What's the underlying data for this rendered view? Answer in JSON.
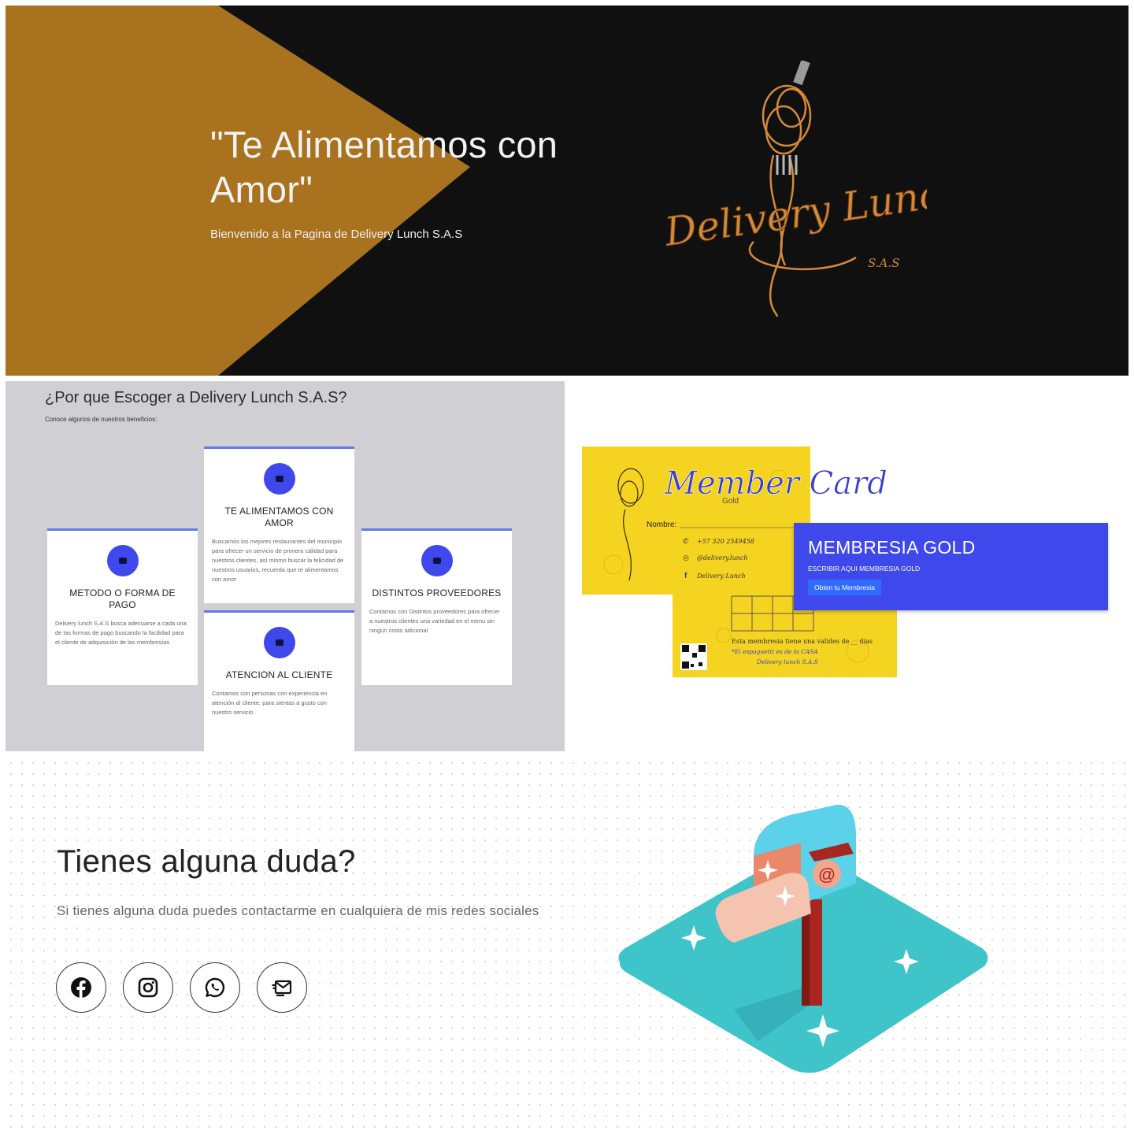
{
  "hero": {
    "title": "\"Te Alimentamos con Amor\"",
    "subtitle": "Bienvenido a la Pagina de Delivery Lunch S.A.S",
    "logo_text": "Delivery Lunch",
    "logo_suffix": "S.A.S",
    "colors": {
      "background": "#101010",
      "accent": "#a8721f"
    }
  },
  "benefits": {
    "title": "¿Por que Escoger a Delivery Lunch S.A.S?",
    "subtitle": "Conoce algunos de nuestros beneficios:",
    "cards": [
      {
        "icon": "wallet-icon",
        "title": "METODO O FORMA DE PAGO",
        "text": "Delivery lunch S.A.S busca adecuarse a cada una de las formas de pago buscando la facilidad para el cliente de adquisición de las membresías"
      },
      {
        "icon": "heart-icon",
        "title": "TE ALIMENTAMOS CON AMOR",
        "text": "Buscamos los mejores restaurantes del municipio para ofrecer un servicio de primera calidad para nuestros clientes, así mismo buscar la felicidad de nuestros usuarios, recuerda que te alimentamos con amor"
      },
      {
        "icon": "truck-icon",
        "title": "DISTINTOS PROVEEDORES",
        "text": "Contamos con Distintos proveedores para ofrecer a nuestros clientes una variedad en el menu sin ningun costo adicional"
      },
      {
        "icon": "smile-icon",
        "title": "ATENCION AL CLIENTE",
        "text": "Contamos con personas con experiencia en atención al cliente, para sientas a gusto con nuestro servicio"
      }
    ],
    "colors": {
      "background": "#d0d0d4",
      "accent": "#3f48ea"
    }
  },
  "membership": {
    "card": {
      "title": "Member Card",
      "tier": "Gold",
      "name_label": "Nombre:",
      "phone": "+57 320 2549458",
      "instagram": "@delivery.lunch",
      "facebook": "Delivery Lunch",
      "validity": "Esta membresia tiene una valides de __ dias",
      "note": "*El espaguetti es de la CASA",
      "brand": "Delivery lunch S.A.S"
    },
    "gold": {
      "title": "MEMBRESIA GOLD",
      "subtitle": "ESCRIBIR AQUI MEMBRESIA GOLD",
      "button": "Obten tu Membresia"
    },
    "colors": {
      "card": "#f5d321",
      "panel": "#3f48ea",
      "button": "#2f6bff"
    }
  },
  "contact": {
    "title": "Tienes alguna duda?",
    "subtitle": "Si tienes alguna duda puedes contactarme en cualquiera de mis redes sociales",
    "socials": [
      "facebook-icon",
      "instagram-icon",
      "whatsapp-icon",
      "email-icon"
    ],
    "illustration_symbol": "@",
    "colors": {
      "platform": "#3fc4ca",
      "mailbox": "#5bd2ea"
    }
  }
}
